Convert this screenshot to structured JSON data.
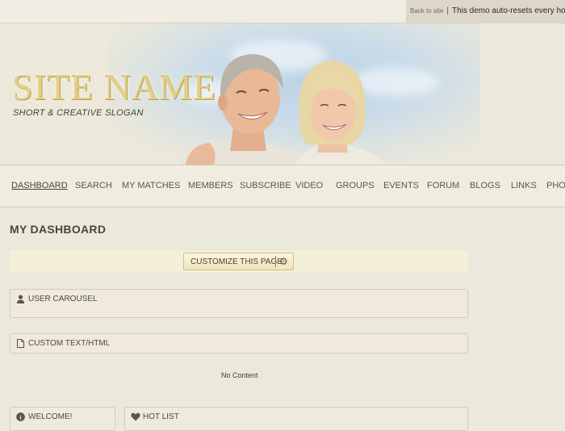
{
  "topbar": {
    "back_link": "Back to site",
    "separator": "|",
    "demo_message": "This demo auto-resets every hour"
  },
  "header": {
    "site_name": "SITE NAME",
    "slogan": "SHORT & CREATIVE SLOGAN"
  },
  "nav": {
    "items": [
      {
        "label": "DASHBOARD",
        "active": true
      },
      {
        "label": "SEARCH"
      },
      {
        "label": "MY MATCHES"
      },
      {
        "label": "MEMBERS"
      },
      {
        "label": "SUBSCRIBE"
      },
      {
        "label": "VIDEO"
      },
      {
        "label": "GROUPS"
      },
      {
        "label": "EVENTS"
      },
      {
        "label": "FORUM"
      },
      {
        "label": "BLOGS"
      },
      {
        "label": "LINKS"
      },
      {
        "label": "PHOTOS"
      }
    ]
  },
  "main": {
    "page_title": "MY DASHBOARD",
    "customize_label": "CUSTOMIZE THIS PAGE",
    "panels": {
      "user_carousel": {
        "title": "USER CAROUSEL",
        "icon": "user-icon"
      },
      "custom_text": {
        "title": "CUSTOM TEXT/HTML",
        "icon": "document-icon",
        "body": "No Content"
      },
      "welcome": {
        "title": "WELCOME!",
        "icon": "info-icon"
      },
      "hot_list": {
        "title": "HOT LIST",
        "icon": "heart-icon"
      }
    }
  }
}
